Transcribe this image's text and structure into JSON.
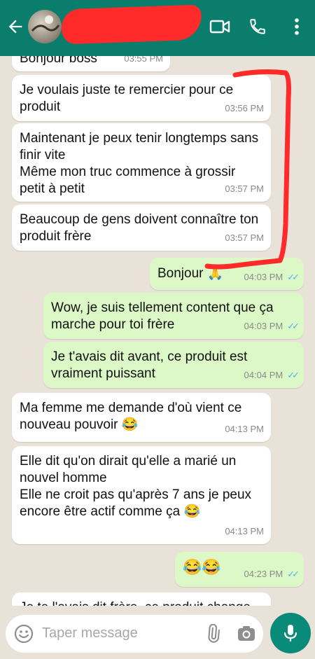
{
  "header": {
    "icons": [
      "back-arrow-icon",
      "video-call-icon",
      "phone-icon",
      "more-vertical-icon"
    ]
  },
  "messages": [
    {
      "dir": "in",
      "text": "Bonjour boss",
      "time": "03:55 PM"
    },
    {
      "dir": "in",
      "text": "Je voulais juste te remercier pour ce produit",
      "time": "03:56 PM"
    },
    {
      "dir": "in",
      "text": "Maintenant je peux tenir longtemps sans finir vite\nMême mon truc commence à grossir petit à petit",
      "time": "03:57 PM"
    },
    {
      "dir": "in",
      "text": "Beaucoup de gens doivent connaître ton produit frère",
      "time": "03:57 PM"
    },
    {
      "dir": "out",
      "text": "Bonjour",
      "emoji": "🙏",
      "time": "04:03 PM"
    },
    {
      "dir": "out",
      "text": "Wow, je suis tellement content que ça marche pour toi frère",
      "time": "04:03 PM"
    },
    {
      "dir": "out",
      "text": "Je t'avais dit avant, ce produit est vraiment puissant",
      "time": "04:04 PM"
    },
    {
      "dir": "in",
      "text": "Ma femme me demande d'où vient ce nouveau pouvoir",
      "emoji": "😂",
      "time": "04:13 PM"
    },
    {
      "dir": "in",
      "text": "Elle dit qu'on dirait qu'elle a marié un nouvel homme\nElle ne croit pas qu'après 7 ans je peux encore être actif comme ça",
      "emoji": "😂",
      "time": "04:13 PM"
    },
    {
      "dir": "out",
      "text": "",
      "emoji": "😂😂",
      "time": "04:23 PM"
    },
    {
      "dir": "in",
      "text": "Je te l'avais dit frère, ce produit change",
      "time": ""
    }
  ],
  "composer": {
    "placeholder": "Taper message",
    "icons": [
      "emoji-icon",
      "attach-icon",
      "camera-icon",
      "mic-icon"
    ]
  },
  "colors": {
    "header": "#0a7d6c",
    "outgoing": "#dcf8c6",
    "incoming": "#ffffff",
    "read_ticks": "#4fb6ec",
    "annotation": "#ff2a2a"
  }
}
